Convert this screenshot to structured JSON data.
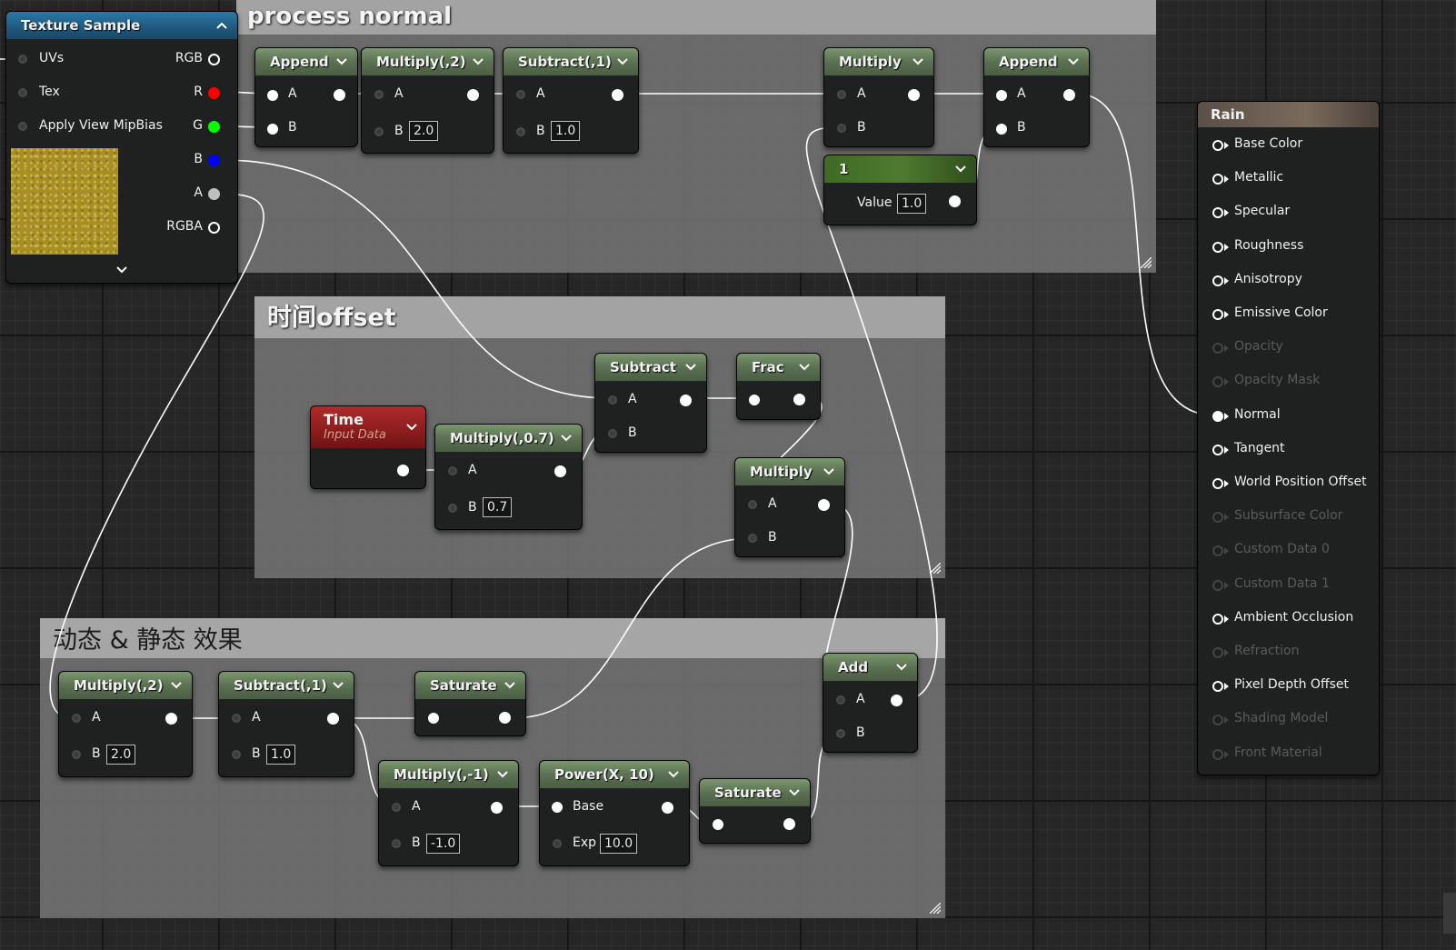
{
  "comments": {
    "process_normal": "process normal",
    "time_offset": "时间offset",
    "dynamic_static": "动态 & 静态 效果"
  },
  "texture_sample": {
    "title": "Texture Sample",
    "inputs": [
      "UVs",
      "Tex",
      "Apply View MipBias"
    ],
    "outputs": [
      {
        "label": "RGB",
        "color": "#ffffff"
      },
      {
        "label": "R",
        "color": "#ff0000"
      },
      {
        "label": "G",
        "color": "#00ff00"
      },
      {
        "label": "B",
        "color": "#0000ff"
      },
      {
        "label": "A",
        "color": "#bfbfbf"
      },
      {
        "label": "RGBA",
        "color": "#ffffff"
      }
    ]
  },
  "nodes": {
    "append1": {
      "title": "Append",
      "a": "A",
      "b": "B"
    },
    "multiply_2_top": {
      "title": "Multiply(,2)",
      "a": "A",
      "b": "B",
      "b_value": "2.0"
    },
    "subtract_1_top": {
      "title": "Subtract(,1)",
      "a": "A",
      "b": "B",
      "b_value": "1.0"
    },
    "multiply_top": {
      "title": "Multiply",
      "a": "A",
      "b": "B"
    },
    "append2": {
      "title": "Append",
      "a": "A",
      "b": "B"
    },
    "constant": {
      "title": "1",
      "value_label": "Value",
      "value": "1.0"
    },
    "time": {
      "title": "Time",
      "subtitle": "Input Data"
    },
    "multiply_07": {
      "title": "Multiply(,0.7)",
      "a": "A",
      "b": "B",
      "b_value": "0.7"
    },
    "subtract_mid": {
      "title": "Subtract",
      "a": "A",
      "b": "B"
    },
    "frac": {
      "title": "Frac"
    },
    "multiply_mid": {
      "title": "Multiply",
      "a": "A",
      "b": "B"
    },
    "multiply_2_bot": {
      "title": "Multiply(,2)",
      "a": "A",
      "b": "B",
      "b_value": "2.0"
    },
    "subtract_1_bot": {
      "title": "Subtract(,1)",
      "a": "A",
      "b": "B",
      "b_value": "1.0"
    },
    "saturate1": {
      "title": "Saturate"
    },
    "add": {
      "title": "Add",
      "a": "A",
      "b": "B"
    },
    "multiply_neg1": {
      "title": "Multiply(,-1)",
      "a": "A",
      "b": "B",
      "b_value": "-1.0"
    },
    "power": {
      "title": "Power(X, 10)",
      "base": "Base",
      "exp": "Exp",
      "exp_value": "10.0"
    },
    "saturate2": {
      "title": "Saturate"
    }
  },
  "material": {
    "title": "Rain",
    "pins": [
      {
        "label": "Base Color",
        "active": true
      },
      {
        "label": "Metallic",
        "active": true
      },
      {
        "label": "Specular",
        "active": true
      },
      {
        "label": "Roughness",
        "active": true
      },
      {
        "label": "Anisotropy",
        "active": true
      },
      {
        "label": "Emissive Color",
        "active": true
      },
      {
        "label": "Opacity",
        "active": false
      },
      {
        "label": "Opacity Mask",
        "active": false
      },
      {
        "label": "Normal",
        "active": true,
        "connected": true
      },
      {
        "label": "Tangent",
        "active": true
      },
      {
        "label": "World Position Offset",
        "active": true
      },
      {
        "label": "Subsurface Color",
        "active": false
      },
      {
        "label": "Custom Data 0",
        "active": false
      },
      {
        "label": "Custom Data 1",
        "active": false
      },
      {
        "label": "Ambient Occlusion",
        "active": true
      },
      {
        "label": "Refraction",
        "active": false
      },
      {
        "label": "Pixel Depth Offset",
        "active": true
      },
      {
        "label": "Shading Model",
        "active": false
      },
      {
        "label": "Front Material",
        "active": false
      }
    ]
  },
  "colors": {
    "function_header": "#5b7152",
    "time_header": "#8a1d1d",
    "constant_header": "#4f7a2f",
    "texture_header": "#1f5a7f",
    "material_header": "#6a5d50",
    "wire": "#ffffff"
  }
}
